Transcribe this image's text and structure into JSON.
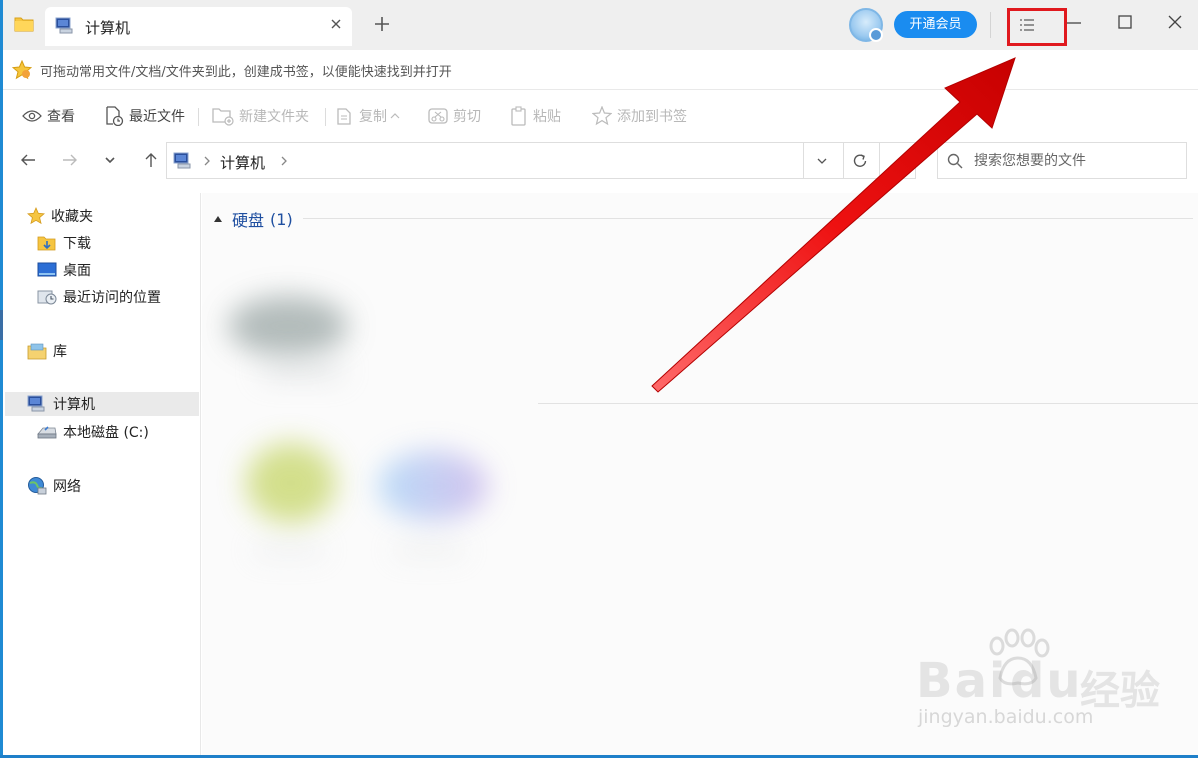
{
  "tab": {
    "title": "计算机"
  },
  "header": {
    "vip_label": "开通会员"
  },
  "bookmark_bar": {
    "hint": "可拖动常用文件/文档/文件夹到此，创建成书签，以便能快速找到并打开"
  },
  "toolbar": {
    "items": [
      {
        "label": "查看",
        "icon": "eye-icon",
        "enabled": true
      },
      {
        "label": "最近文件",
        "icon": "recent-file-icon",
        "enabled": true
      },
      {
        "label": "新建文件夹",
        "icon": "new-folder-icon",
        "enabled": false
      },
      {
        "label": "复制",
        "icon": "copy-icon",
        "enabled": false
      },
      {
        "label": "剪切",
        "icon": "scissors-icon",
        "enabled": false
      },
      {
        "label": "粘贴",
        "icon": "clipboard-icon",
        "enabled": false
      },
      {
        "label": "添加到书签",
        "icon": "star-add-icon",
        "enabled": false
      }
    ]
  },
  "address": {
    "current": "计算机"
  },
  "search": {
    "placeholder": "搜索您想要的文件"
  },
  "sidebar": {
    "favorites": "收藏夹",
    "downloads": "下载",
    "desktop": "桌面",
    "recent_places": "最近访问的位置",
    "library": "库",
    "computer": "计算机",
    "local_disk": "本地磁盘 (C:)",
    "network": "网络"
  },
  "content": {
    "group_title": "硬盘",
    "group_count": "(1)"
  },
  "watermark": {
    "brand": "Bai",
    "brand2": "du",
    "cn": "经验",
    "url": "jingyan.baidu.com"
  },
  "colors": {
    "accent": "#1a8cf0",
    "highlight_box": "#e0191e",
    "group_title": "#1f4fa0"
  }
}
